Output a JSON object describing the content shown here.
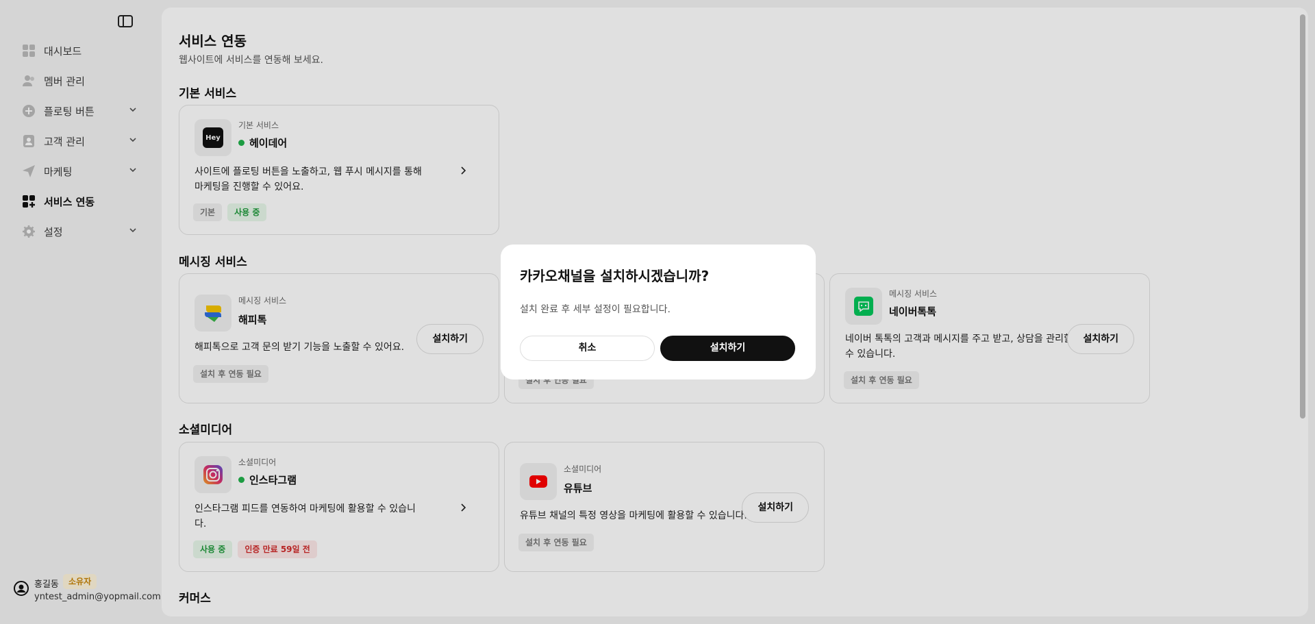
{
  "sidebar": {
    "items": [
      {
        "label": "대시보드",
        "icon": "dashboard-icon"
      },
      {
        "label": "멤버 관리",
        "icon": "members-icon"
      },
      {
        "label": "플로팅 버튼",
        "icon": "plus-circle-icon"
      },
      {
        "label": "고객 관리",
        "icon": "customer-icon"
      },
      {
        "label": "마케팅",
        "icon": "send-icon"
      },
      {
        "label": "서비스 연동",
        "icon": "integration-icon"
      },
      {
        "label": "설정",
        "icon": "gear-icon"
      }
    ],
    "profile": {
      "name": "홍길동",
      "role": "소유자",
      "email": "yntest_admin@yopmail.com"
    }
  },
  "page": {
    "title": "서비스 연동",
    "subtitle": "웹사이트에 서비스를 연동해 보세요."
  },
  "sections": {
    "basic": "기본 서비스",
    "messaging": "메시징 서비스",
    "social": "소셜미디어",
    "commerce": "커머스"
  },
  "cards": {
    "heydeer": {
      "category": "기본 서비스",
      "name": "헤이데어",
      "desc1": "사이트에 플로팅 버튼을 노출하고, 웹 푸시 메시지를 통해",
      "desc2": "마케팅을 진행할 수 있어요.",
      "tag1": "기본",
      "tag2": "사용 중",
      "logo_text": "Hey"
    },
    "happytalk": {
      "category": "메시징 서비스",
      "name": "해피톡",
      "desc1": "해피톡으로 고객 문의 받기 기능을 노출할 수 있어요.",
      "tag1": "설치 후 연동 필요",
      "install": "설치하기"
    },
    "kakao": {
      "tag1": "설치 후 연동 필요"
    },
    "naver": {
      "category": "메시징 서비스",
      "name": "네이버톡톡",
      "desc1": "네이버 톡톡의 고객과 메시지를 주고 받고, 상담을 관리할",
      "desc2": "수 있습니다.",
      "tag1": "설치 후 연동 필요",
      "install": "설치하기"
    },
    "instagram": {
      "category": "소셜미디어",
      "name": "인스타그램",
      "desc1": "인스타그램 피드를 연동하여 마케팅에 활용할 수 있습니",
      "desc2": "다.",
      "tag1": "사용 중",
      "tag2": "인증 만료 59일 전"
    },
    "youtube": {
      "category": "소셜미디어",
      "name": "유튜브",
      "desc1": "유튜브 채널의 특정 영상을 마케팅에 활용할 수 있습니다.",
      "tag1": "설치 후 연동 필요",
      "install": "설치하기"
    }
  },
  "modal": {
    "title": "카카오채널을 설치하시겠습니까?",
    "body": "설치 완료 후 세부 설정이 필요합니다.",
    "cancel": "취소",
    "confirm": "설치하기"
  },
  "colors": {
    "active_green": "#22b24c",
    "primary": "#111111",
    "naver_green": "#03c75a",
    "youtube_red": "#ff0000"
  }
}
